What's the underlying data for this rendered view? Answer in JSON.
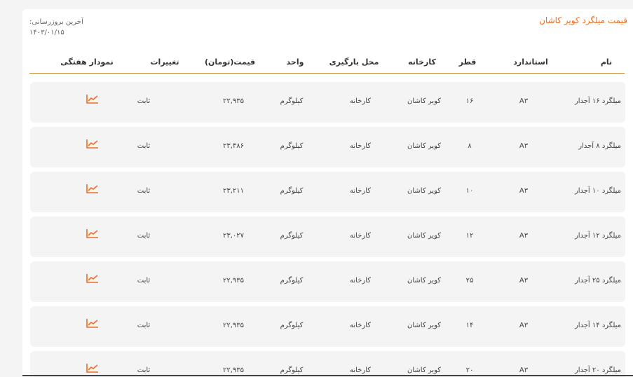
{
  "page": {
    "title": "قیمت میلگرد کویر کاشان",
    "last_update_label": "آخرین بروزرسانی:",
    "last_update_date": "۱۴۰۳/۰۱/۱۵"
  },
  "table": {
    "headers": {
      "name": "نام",
      "standard": "استاندارد",
      "diameter": "قطر",
      "factory": "کارخانه",
      "loading_place": "محل بارگیری",
      "unit": "واحد",
      "price": "قیمت(تومان)",
      "changes": "تغییرات",
      "weekly_chart": "نمودار هفتگی"
    },
    "rows": [
      {
        "name": "میلگرد ۱۶ آجدار",
        "standard": "A۳",
        "diameter": "۱۶",
        "factory": "کویر کاشان",
        "loading_place": "کارخانه",
        "unit": "کیلوگرم",
        "price": "۲۲,۹۳۵",
        "change": "ثابت"
      },
      {
        "name": "میلگرد ۸ آجدار",
        "standard": "A۳",
        "diameter": "۸",
        "factory": "کویر کاشان",
        "loading_place": "کارخانه",
        "unit": "کیلوگرم",
        "price": "۲۳,۴۸۶",
        "change": "ثابت"
      },
      {
        "name": "میلگرد ۱۰ آجدار",
        "standard": "A۳",
        "diameter": "۱۰",
        "factory": "کویر کاشان",
        "loading_place": "کارخانه",
        "unit": "کیلوگرم",
        "price": "۲۳,۲۱۱",
        "change": "ثابت"
      },
      {
        "name": "میلگرد ۱۲ آجدار",
        "standard": "A۳",
        "diameter": "۱۲",
        "factory": "کویر کاشان",
        "loading_place": "کارخانه",
        "unit": "کیلوگرم",
        "price": "۲۳,۰۲۷",
        "change": "ثابت"
      },
      {
        "name": "میلگرد ۲۵ آجدار",
        "standard": "A۳",
        "diameter": "۲۵",
        "factory": "کویر کاشان",
        "loading_place": "کارخانه",
        "unit": "کیلوگرم",
        "price": "۲۲,۹۳۵",
        "change": "ثابت"
      },
      {
        "name": "میلگرد ۱۴ آجدار",
        "standard": "A۳",
        "diameter": "۱۴",
        "factory": "کویر کاشان",
        "loading_place": "کارخانه",
        "unit": "کیلوگرم",
        "price": "۲۲,۹۳۵",
        "change": "ثابت"
      },
      {
        "name": "میلگرد ۲۰ آجدار",
        "standard": "A۳",
        "diameter": "۲۰",
        "factory": "کویر کاشان",
        "loading_place": "کارخانه",
        "unit": "کیلوگرم",
        "price": "۲۲,۹۳۵",
        "change": "ثابت"
      }
    ]
  },
  "icons": {
    "chart": "line-chart-icon"
  },
  "colors": {
    "accent": "#f26d21",
    "row_bg": "#f4f4f4",
    "header_rule": "#c98a3c"
  }
}
